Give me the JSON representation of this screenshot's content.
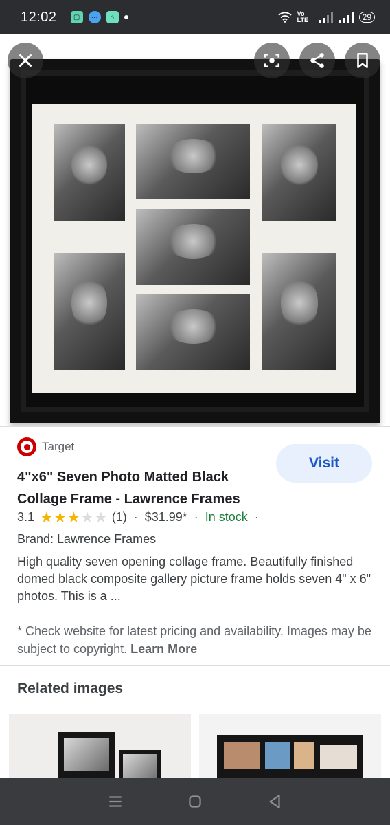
{
  "status_bar": {
    "time": "12:02",
    "network": "Vo LTE",
    "battery": "29"
  },
  "viewer": {
    "close_icon": "close-icon",
    "lens_icon": "lens-icon",
    "share_icon": "share-icon",
    "bookmark_icon": "bookmark-icon"
  },
  "product": {
    "source": "Target",
    "visit_label": "Visit",
    "title": "4\"x6\" Seven Photo Matted Black Collage Frame - Lawrence Frames",
    "rating": "3.1",
    "rating_stars": 3,
    "review_count": "(1)",
    "separator": "·",
    "price": "$31.99*",
    "stock": "In stock",
    "brand": "Brand: Lawrence Frames",
    "description": "High quality seven opening collage frame. Beautifully finished domed black composite gallery picture frame holds seven 4\" x 6\" photos. This is a ...",
    "notice": "* Check website for latest pricing and availability. Images may be subject to copyright.",
    "learn_more": "Learn More"
  },
  "related": {
    "title": "Related images"
  },
  "colors": {
    "accent": "#1a56c5",
    "visit_bg": "#e8f0fe",
    "in_stock": "#188038",
    "star": "#f4b400",
    "target_red": "#cc0000"
  }
}
